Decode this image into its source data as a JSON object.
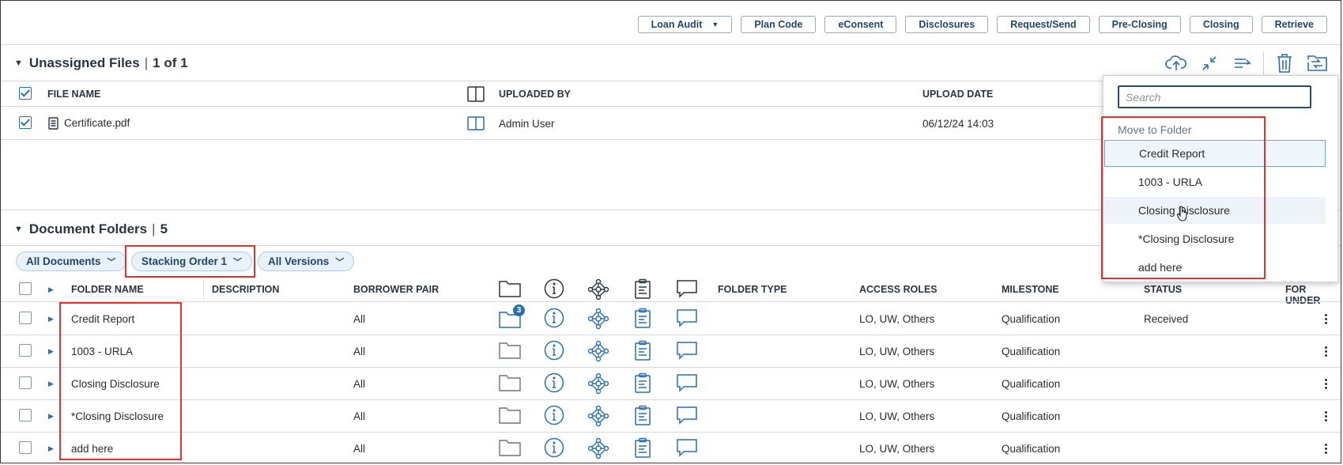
{
  "toolbar": {
    "buttons": [
      "Loan Audit",
      "Plan Code",
      "eConsent",
      "Disclosures",
      "Request/Send",
      "Pre-Closing",
      "Closing",
      "Retrieve"
    ],
    "loan_audit_caret": "▼"
  },
  "unassigned": {
    "title": "Unassigned Files",
    "count": "1 of 1",
    "columns": {
      "file_name": "FILE NAME",
      "uploaded_by": "UPLOADED BY",
      "upload_date": "UPLOAD DATE"
    },
    "rows": [
      {
        "file_name": "Certificate.pdf",
        "uploaded_by": "Admin User",
        "upload_date": "06/12/24 14:03",
        "checked": true
      }
    ],
    "select_all_checked": true,
    "icons": [
      "cloud-upload-icon",
      "collapse-icon",
      "sort-icon",
      "trash-icon",
      "move-folder-icon"
    ]
  },
  "folders": {
    "title": "Document Folders",
    "count": "5",
    "filters": [
      "All Documents",
      "Stacking Order 1",
      "All Versions"
    ],
    "columns": {
      "folder_name": "FOLDER NAME",
      "description": "DESCRIPTION",
      "borrower_pair": "BORROWER PAIR",
      "folder_type": "FOLDER TYPE",
      "access_roles": "ACCESS ROLES",
      "milestone": "MILESTONE",
      "status": "STATUS",
      "for_under": "FOR UNDER"
    },
    "icon_columns": [
      "folder-icon",
      "info-icon",
      "network-icon",
      "clipboard-icon",
      "comment-icon"
    ],
    "folder_badge": "3",
    "rows": [
      {
        "name": "Credit Report",
        "borrower_pair": "All",
        "access_roles": "LO, UW, Others",
        "milestone": "Qualification",
        "status": "Received"
      },
      {
        "name": "1003 - URLA",
        "borrower_pair": "All",
        "access_roles": "LO, UW, Others",
        "milestone": "Qualification",
        "status": ""
      },
      {
        "name": "Closing Disclosure",
        "borrower_pair": "All",
        "access_roles": "LO, UW, Others",
        "milestone": "Qualification",
        "status": ""
      },
      {
        "name": "*Closing Disclosure",
        "borrower_pair": "All",
        "access_roles": "LO, UW, Others",
        "milestone": "Qualification",
        "status": ""
      },
      {
        "name": "add here",
        "borrower_pair": "All",
        "access_roles": "LO, UW, Others",
        "milestone": "Qualification",
        "status": ""
      }
    ]
  },
  "move_dropdown": {
    "search_placeholder": "Search",
    "header": "Move to Folder",
    "items": [
      "Credit Report",
      "1003 - URLA",
      "Closing Disclosure",
      "*Closing Disclosure",
      "add here"
    ],
    "selected_index": 0,
    "hovered_index": 2
  },
  "colors": {
    "accent": "#2a6fb0",
    "highlight_box": "#e0322f",
    "pill_bg": "#e9f2fb"
  }
}
